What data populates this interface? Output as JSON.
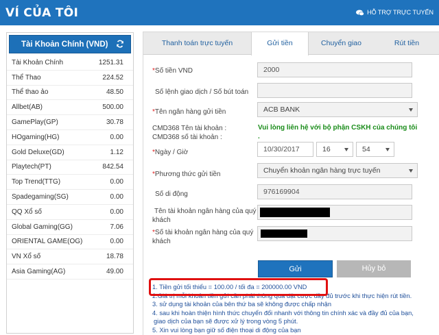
{
  "header": {
    "title": "VÍ CỦA TÔI",
    "support_label": "HỖ TRỢ TRỰC TUYẾN"
  },
  "main_account": {
    "label": "Tài Khoản Chính (VND)"
  },
  "accounts": [
    {
      "name": "Tài Khoản Chính",
      "value": "1251.31"
    },
    {
      "name": "Thể Thao",
      "value": "224.52"
    },
    {
      "name": "Thể thao ảo",
      "value": "48.50"
    },
    {
      "name": "Allbet(AB)",
      "value": "500.00"
    },
    {
      "name": "GamePlay(GP)",
      "value": "30.78"
    },
    {
      "name": "HOgaming(HG)",
      "value": "0.00"
    },
    {
      "name": "Gold Deluxe(GD)",
      "value": "1.12"
    },
    {
      "name": "Playtech(PT)",
      "value": "842.54"
    },
    {
      "name": "Top Trend(TTG)",
      "value": "0.00"
    },
    {
      "name": "Spadegaming(SG)",
      "value": "0.00"
    },
    {
      "name": "QQ Xổ số",
      "value": "0.00"
    },
    {
      "name": "Global Gaming(GG)",
      "value": "7.06"
    },
    {
      "name": "ORIENTAL GAME(OG)",
      "value": "0.00"
    },
    {
      "name": "VN Xổ số",
      "value": "18.78"
    },
    {
      "name": "Asia Gaming(AG)",
      "value": "49.00"
    }
  ],
  "tabs": [
    {
      "label": "Thanh toán trực tuyến",
      "active": false
    },
    {
      "label": "Gửi tiền",
      "active": true
    },
    {
      "label": "Chuyển giao",
      "active": false
    },
    {
      "label": "Rút tiền",
      "active": false
    }
  ],
  "form": {
    "amount_label": "Số tiền VND",
    "amount_value": "2000",
    "txn_label": "Số lệnh giao dịch / Số bút toán",
    "txn_value": "",
    "bank_label": "Tên ngân hàng gửi tiền",
    "bank_value": "ACB BANK",
    "cmd_name_label": "CMD368 Tên tài khoản :",
    "cmd_number_label": "CMD368 số tài khoản :",
    "contact_notice": "Vui lòng liên hệ với bộ phận CSKH của chúng tôi",
    "contact_notice_dot": ".",
    "datetime_label": "Ngày / Giờ",
    "date_value": "10/30/2017",
    "hour_value": "16",
    "minute_value": "54",
    "method_label": "Phương thức gửi tiền",
    "method_value": "Chuyển khoản ngân hàng trực tuyến",
    "phone_label": "Số di động",
    "phone_value": "976169904",
    "holder_label_1": "Tên tài khoản ngân hàng của quý",
    "holder_label_2": "khách",
    "account_no_label_1": "Số tài khoản ngân hàng của quý",
    "account_no_label_2": "khách",
    "required_mark": "*"
  },
  "buttons": {
    "send": "Gửi",
    "cancel": "Hủy bỏ"
  },
  "rules": [
    "1. Tiền gửi tối thiểu = 100.00 / tối đa = 200000.00 VND",
    "2.Giá trị mỗi khoản tiền gửi cần phải thông qua đặt cược đầy đủ trước khi thực hiện rút tiền.",
    "3. sử dụng tài khoản của bên thứ ba sẽ không được chấp nhận",
    "4. sau khi hoàn thiện hình thức chuyển đổi nhanh với thông tin chính xác và đầy đủ của bạn,",
    "giao dịch của bạn sẽ được xử lý trong vòng 5 phút.",
    "5. Xin vui lòng bạn giữ số điện thoại di động của bạn"
  ],
  "colors": {
    "brand_blue": "#1f73bd",
    "cancel_gray": "#b7b7b7",
    "notice_green": "#1a8c1a",
    "highlight_red": "#e01010"
  }
}
